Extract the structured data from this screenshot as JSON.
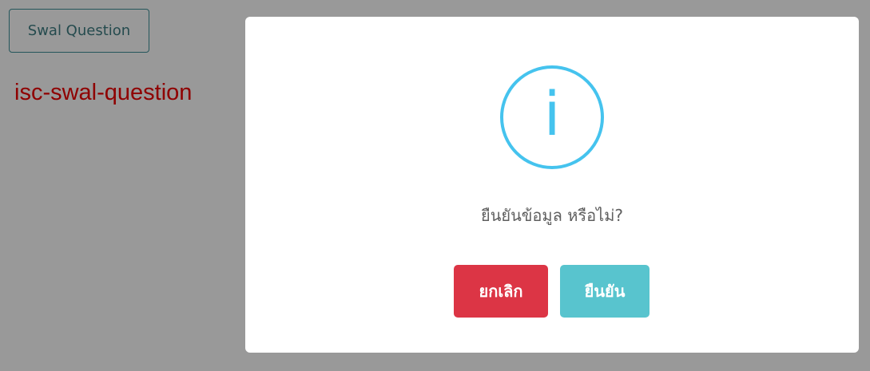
{
  "page": {
    "trigger_button_label": "Swal Question",
    "component_name_label": "isc-swal-question"
  },
  "modal": {
    "icon": "info-icon",
    "icon_glyph": "i",
    "message": "ยืนยันข้อมูล หรือไม่?",
    "cancel_label": "ยกเลิก",
    "confirm_label": "ยืนยัน"
  },
  "colors": {
    "info_icon": "#45c3ee",
    "cancel_button": "#dc3545",
    "confirm_button": "#58c4ce",
    "label_text": "#ee0000",
    "trigger_border": "#3d8f98"
  }
}
